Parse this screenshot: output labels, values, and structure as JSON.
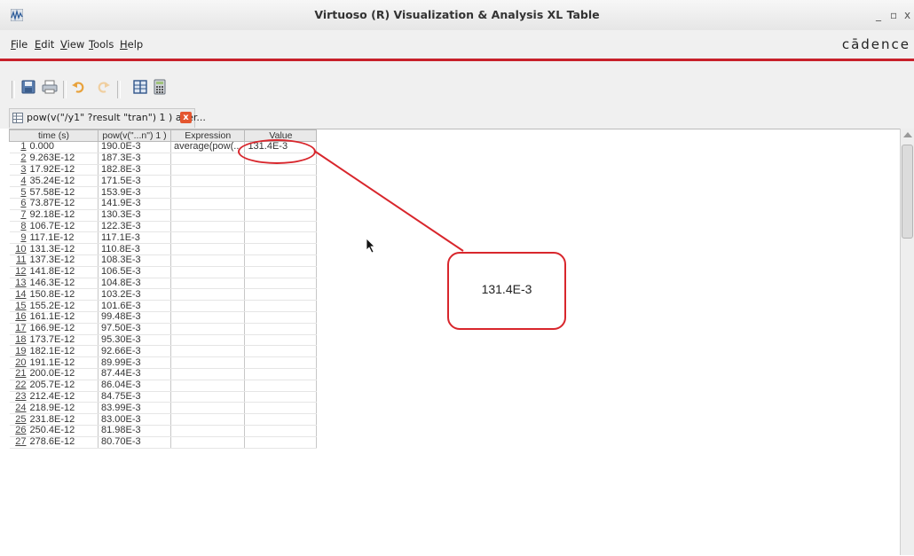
{
  "window": {
    "title": "Virtuoso (R) Visualization & Analysis XL Table",
    "controls": {
      "minimize": "_",
      "maximize": "▫",
      "close": "x"
    }
  },
  "menu": {
    "items": [
      {
        "label": "File",
        "mnemonic": "F",
        "rest": "ile"
      },
      {
        "label": "Edit",
        "mnemonic": "E",
        "rest": "dit"
      },
      {
        "label": "View",
        "mnemonic": "V",
        "rest": "iew"
      },
      {
        "label": "Tools",
        "mnemonic": "T",
        "rest": "ools"
      },
      {
        "label": "Help",
        "mnemonic": "H",
        "rest": "elp"
      }
    ],
    "brand": "cādence"
  },
  "toolbar": {
    "icons": [
      "save-icon",
      "print-icon",
      "undo-icon",
      "redo-icon",
      "table-columns-icon",
      "calculator-icon"
    ]
  },
  "tab": {
    "label": "pow(v(\"/y1\" ?result \"tran\") 1 ) aver...",
    "close": "x"
  },
  "table": {
    "headers": [
      "time (s)",
      "pow(v(\"...n\") 1 )",
      "Expression",
      "Value"
    ],
    "rows": [
      {
        "n": "1",
        "time": "0.000",
        "pow": "190.0E-3",
        "expression": "average(pow(...",
        "value": "131.4E-3"
      },
      {
        "n": "2",
        "time": "9.263E-12",
        "pow": "187.3E-3",
        "expression": "",
        "value": ""
      },
      {
        "n": "3",
        "time": "17.92E-12",
        "pow": "182.8E-3",
        "expression": "",
        "value": ""
      },
      {
        "n": "4",
        "time": "35.24E-12",
        "pow": "171.5E-3",
        "expression": "",
        "value": ""
      },
      {
        "n": "5",
        "time": "57.58E-12",
        "pow": "153.9E-3",
        "expression": "",
        "value": ""
      },
      {
        "n": "6",
        "time": "73.87E-12",
        "pow": "141.9E-3",
        "expression": "",
        "value": ""
      },
      {
        "n": "7",
        "time": "92.18E-12",
        "pow": "130.3E-3",
        "expression": "",
        "value": ""
      },
      {
        "n": "8",
        "time": "106.7E-12",
        "pow": "122.3E-3",
        "expression": "",
        "value": ""
      },
      {
        "n": "9",
        "time": "117.1E-12",
        "pow": "117.1E-3",
        "expression": "",
        "value": ""
      },
      {
        "n": "10",
        "time": "131.3E-12",
        "pow": "110.8E-3",
        "expression": "",
        "value": ""
      },
      {
        "n": "11",
        "time": "137.3E-12",
        "pow": "108.3E-3",
        "expression": "",
        "value": ""
      },
      {
        "n": "12",
        "time": "141.8E-12",
        "pow": "106.5E-3",
        "expression": "",
        "value": ""
      },
      {
        "n": "13",
        "time": "146.3E-12",
        "pow": "104.8E-3",
        "expression": "",
        "value": ""
      },
      {
        "n": "14",
        "time": "150.8E-12",
        "pow": "103.2E-3",
        "expression": "",
        "value": ""
      },
      {
        "n": "15",
        "time": "155.2E-12",
        "pow": "101.6E-3",
        "expression": "",
        "value": ""
      },
      {
        "n": "16",
        "time": "161.1E-12",
        "pow": "99.48E-3",
        "expression": "",
        "value": ""
      },
      {
        "n": "17",
        "time": "166.9E-12",
        "pow": "97.50E-3",
        "expression": "",
        "value": ""
      },
      {
        "n": "18",
        "time": "173.7E-12",
        "pow": "95.30E-3",
        "expression": "",
        "value": ""
      },
      {
        "n": "19",
        "time": "182.1E-12",
        "pow": "92.66E-3",
        "expression": "",
        "value": ""
      },
      {
        "n": "20",
        "time": "191.1E-12",
        "pow": "89.99E-3",
        "expression": "",
        "value": ""
      },
      {
        "n": "21",
        "time": "200.0E-12",
        "pow": "87.44E-3",
        "expression": "",
        "value": ""
      },
      {
        "n": "22",
        "time": "205.7E-12",
        "pow": "86.04E-3",
        "expression": "",
        "value": ""
      },
      {
        "n": "23",
        "time": "212.4E-12",
        "pow": "84.75E-3",
        "expression": "",
        "value": ""
      },
      {
        "n": "24",
        "time": "218.9E-12",
        "pow": "83.99E-3",
        "expression": "",
        "value": ""
      },
      {
        "n": "25",
        "time": "231.8E-12",
        "pow": "83.00E-3",
        "expression": "",
        "value": ""
      },
      {
        "n": "26",
        "time": "250.4E-12",
        "pow": "81.98E-3",
        "expression": "",
        "value": ""
      },
      {
        "n": "27",
        "time": "278.6E-12",
        "pow": "80.70E-3",
        "expression": "",
        "value": ""
      }
    ]
  },
  "annotation": {
    "callout_text": "131.4E-3",
    "color": "#d8262c"
  },
  "colors": {
    "brand_red": "#c8202a",
    "close_orange": "#e4562f"
  }
}
